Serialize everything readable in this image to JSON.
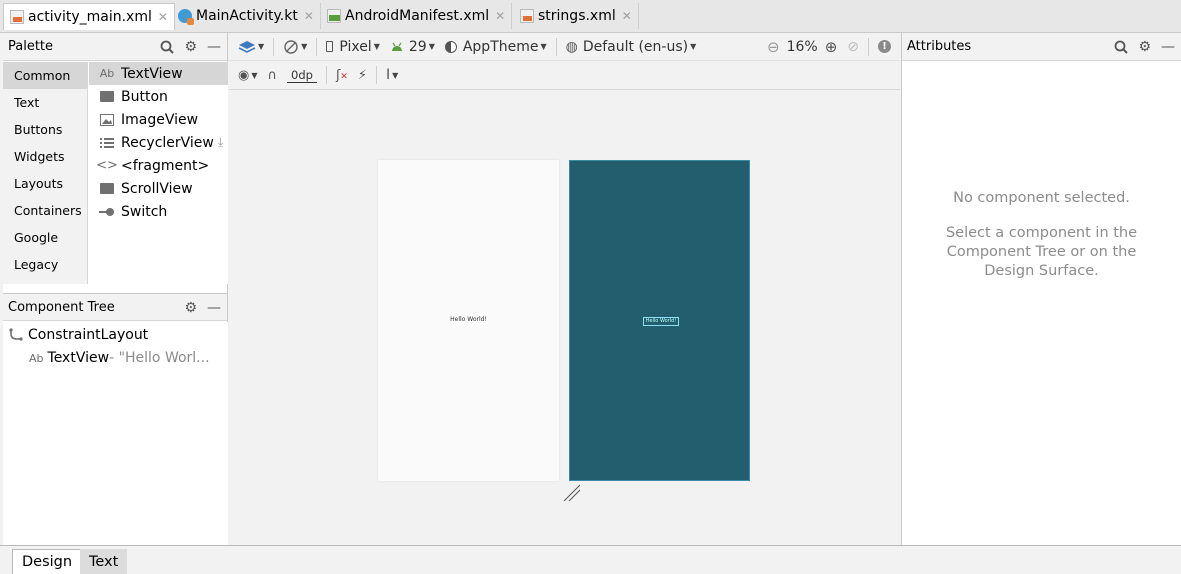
{
  "editor_tabs": [
    {
      "label": "activity_main.xml",
      "icon": "xml-file-icon"
    },
    {
      "label": "MainActivity.kt",
      "icon": "kotlin-file-icon"
    },
    {
      "label": "AndroidManifest.xml",
      "icon": "manifest-file-icon"
    },
    {
      "label": "strings.xml",
      "icon": "xml-file-icon"
    }
  ],
  "palette": {
    "title": "Palette",
    "categories": [
      "Common",
      "Text",
      "Buttons",
      "Widgets",
      "Layouts",
      "Containers",
      "Google",
      "Legacy"
    ],
    "selected_category": "Common",
    "items": [
      "TextView",
      "Button",
      "ImageView",
      "RecyclerView",
      "<fragment>",
      "ScrollView",
      "Switch"
    ],
    "textview_prefix": "Ab"
  },
  "component_tree": {
    "title": "Component Tree",
    "root": "ConstraintLayout",
    "child_prefix": "Ab",
    "child": "TextView",
    "child_suffix": "- \"Hello Worl..."
  },
  "design_toolbar": {
    "device": "Pixel",
    "api": "29",
    "theme": "AppTheme",
    "locale": "Default (en-us)",
    "zoom": "16%",
    "margin": "0dp"
  },
  "preview": {
    "text": "Hello World!"
  },
  "attributes": {
    "title": "Attributes",
    "empty_title": "No component selected.",
    "empty_line1": "Select a component in the",
    "empty_line2": "Component Tree or on the",
    "empty_line3": "Design Surface."
  },
  "bottom_tabs": [
    "Design",
    "Text"
  ],
  "colors": {
    "blueprint": "#225e6d",
    "android_green": "#5a9d3e",
    "accent_blue": "#3d9bd6"
  }
}
